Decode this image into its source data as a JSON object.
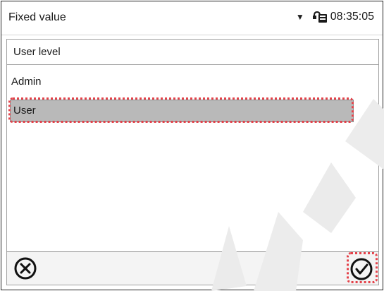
{
  "topbar": {
    "title": "Fixed value",
    "time": "08:35:05",
    "icons": [
      "dropdown-arrow-icon",
      "lock-icon"
    ]
  },
  "list": {
    "header": "User level",
    "options": [
      "Admin",
      "User"
    ],
    "selected": "User"
  },
  "footer": {
    "icons": [
      "cancel-icon",
      "confirm-icon"
    ]
  },
  "colors": {
    "selected_row": "#b9b9b9",
    "highlight": "#e4424a",
    "watermark": "#e6e6e6"
  }
}
